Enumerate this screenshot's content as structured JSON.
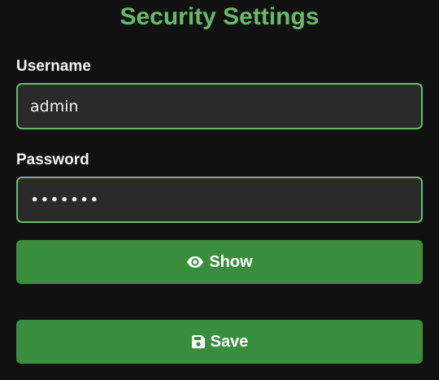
{
  "page": {
    "title": "Security Settings"
  },
  "form": {
    "username_label": "Username",
    "username_value": "admin",
    "password_label": "Password",
    "password_value": "•••••••"
  },
  "buttons": {
    "show_label": "Show",
    "show_icon": "eye-icon",
    "save_label": "Save",
    "save_icon": "floppy-disk-icon"
  },
  "colors": {
    "background": "#111111",
    "accent": "#66bb6a",
    "button": "#388e3c",
    "field_background": "#2a2a2a",
    "text": "#f2f2f2"
  }
}
